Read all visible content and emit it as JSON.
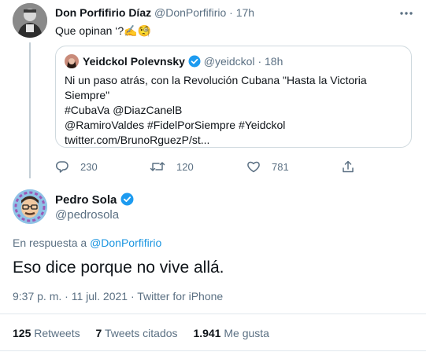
{
  "colors": {
    "link": "#1b95e0",
    "muted": "#5b7083",
    "verified": "#1d9bf0",
    "divider": "#e1e8ed"
  },
  "parent_tweet": {
    "display_name": "Don Porfifirio Díaz",
    "handle": "@DonPorfifirio",
    "dot": "·",
    "time": "17h",
    "text": "Que opinan ‘?✍️🧐",
    "more_icon": "more-icon",
    "quoted": {
      "display_name": "Yeidckol Polevnsky",
      "handle": "@yeidckol",
      "dot": "·",
      "time": "18h",
      "text_line1": "Ni un paso atrás, con la Revolución Cubana \"Hasta la Victoria",
      "text_line2": "Siempre\"",
      "hashtag_cubava": "#CubaVa",
      "mention_diaz": "@DiazCanelB",
      "mention_ramiro": "@RamiroValdes",
      "hashtag_fidel": "#FidelPorSiempre",
      "hashtag_yeidckol": "#Yeidckol",
      "link": "twitter.com/BrunoRguezP/st..."
    },
    "actions": {
      "replies": "230",
      "retweets": "120",
      "likes": "781"
    }
  },
  "main_tweet": {
    "display_name": "Pedro Sola",
    "handle": "@pedrosola",
    "reply_prefix": "En respuesta a",
    "reply_to": "@DonPorfifirio",
    "text": "Eso dice porque no vive allá.",
    "meta": "9:37 p. m. · 11 jul. 2021 · Twitter for iPhone",
    "stats": {
      "retweets_count": "125",
      "retweets_label": "Retweets",
      "quotes_count": "7",
      "quotes_label": "Tweets citados",
      "likes_count": "1.941",
      "likes_label": "Me gusta"
    }
  }
}
